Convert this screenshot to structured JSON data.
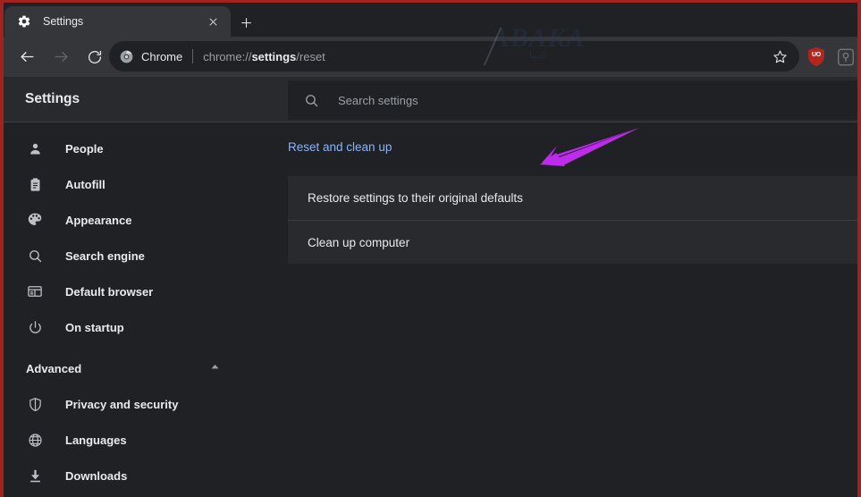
{
  "browser": {
    "tab": {
      "title": "Settings",
      "favicon_icon": "gear-icon",
      "close_icon": "close-icon"
    },
    "new_tab_label": "+",
    "nav": {
      "back_icon": "arrow-left-icon",
      "forward_icon": "arrow-right-icon",
      "reload_icon": "reload-icon"
    },
    "omnibox": {
      "chip_icon": "chrome-logo-icon",
      "chip_label": "Chrome",
      "url_prefix": "chrome://",
      "url_emphasis": "settings",
      "url_suffix": "/reset",
      "bookmark_icon": "star-icon"
    },
    "extension_badge": {
      "icon": "shield-extension-icon",
      "text": "UO",
      "color": "#b3261e"
    },
    "profile_icon": "profile-avatar-icon"
  },
  "watermark": {
    "main": "ABAKA",
    "sub": "كتبها",
    "color": "#2b3a60"
  },
  "settings": {
    "header": {
      "title": "Settings",
      "search_icon": "search-icon",
      "search_placeholder": "Search settings",
      "search_value": ""
    },
    "sidebar": {
      "items": [
        {
          "label": "People",
          "icon": "person-icon"
        },
        {
          "label": "Autofill",
          "icon": "clipboard-icon"
        },
        {
          "label": "Appearance",
          "icon": "palette-icon"
        },
        {
          "label": "Search engine",
          "icon": "search-icon"
        },
        {
          "label": "Default browser",
          "icon": "browser-window-icon"
        },
        {
          "label": "On startup",
          "icon": "power-icon"
        }
      ],
      "advanced": {
        "label": "Advanced",
        "expanded": true,
        "chevron_icon": "chevron-up-icon",
        "items": [
          {
            "label": "Privacy and security",
            "icon": "shield-icon"
          },
          {
            "label": "Languages",
            "icon": "globe-icon"
          },
          {
            "label": "Downloads",
            "icon": "download-icon"
          }
        ]
      }
    },
    "main": {
      "section_heading": "Reset and clean up",
      "rows": [
        {
          "label": "Restore settings to their original defaults"
        },
        {
          "label": "Clean up computer"
        }
      ]
    }
  },
  "annotation": {
    "arrow_color": "#bf2bed",
    "points_to": "Restore settings to their original defaults"
  },
  "theme": {
    "page_background": "#202124",
    "toolbar_background": "#35363a",
    "card_background": "#292a2d",
    "accent_blue": "#8ab4f8",
    "text_primary": "#e8eaed",
    "text_secondary": "#9aa0a6",
    "capture_border": "#a3221f"
  }
}
